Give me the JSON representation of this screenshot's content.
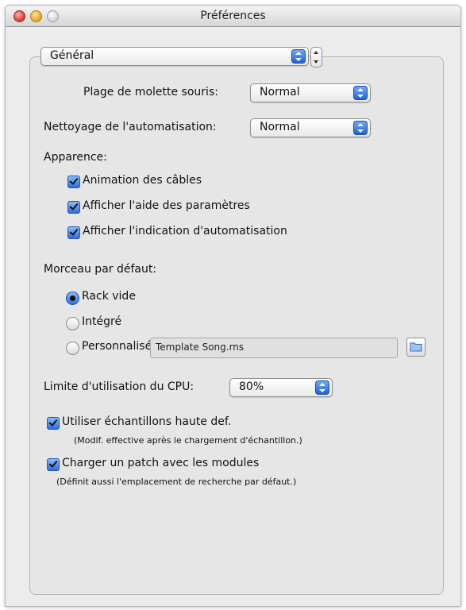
{
  "window": {
    "title": "Préférences",
    "controls": {
      "close": "close-icon",
      "minimize": "minimize-icon",
      "zoom": "zoom-icon"
    }
  },
  "category": {
    "selected": "Général"
  },
  "mouse_wheel": {
    "label": "Plage de molette souris:",
    "value": "Normal"
  },
  "automation_cleanup": {
    "label": "Nettoyage de l'automatisation:",
    "value": "Normal"
  },
  "appearance": {
    "heading": "Apparence:",
    "options": [
      {
        "label": "Animation des câbles",
        "checked": true
      },
      {
        "label": "Afficher l'aide des paramètres",
        "checked": true
      },
      {
        "label": "Afficher l'indication d'automatisation",
        "checked": true
      }
    ]
  },
  "default_song": {
    "heading": "Morceau par défaut:",
    "options": [
      {
        "label": "Rack vide",
        "selected": true
      },
      {
        "label": "Intégré",
        "selected": false
      },
      {
        "label": "Personnalisé:",
        "selected": false
      }
    ],
    "custom_path": "Template Song.rns"
  },
  "cpu": {
    "label": "Limite d'utilisation du CPU:",
    "value": "80%"
  },
  "hires_samples": {
    "label": "Utiliser échantillons haute def.",
    "note": "(Modif. effective après le chargement d'échantillon.)",
    "checked": true
  },
  "load_patch": {
    "label": "Charger un patch avec les modules",
    "note": "(Définit aussi l'emplacement de recherche par défaut.)",
    "checked": true
  },
  "colors": {
    "accent": "#2a6ee0",
    "window_bg": "#ececec"
  }
}
